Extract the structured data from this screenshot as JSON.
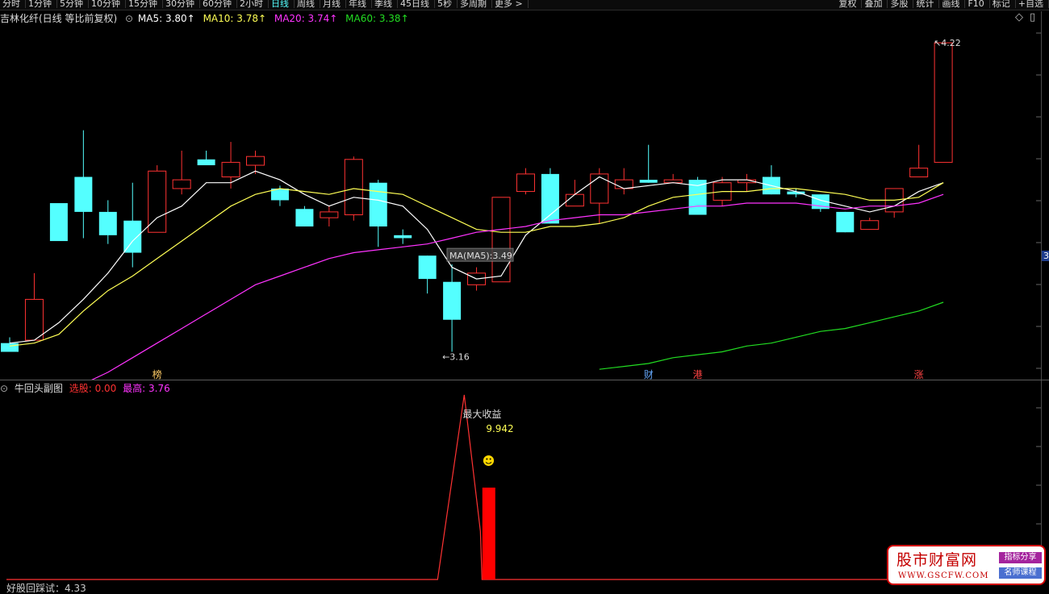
{
  "toolbar": {
    "left_items": [
      "分时",
      "1分钟",
      "5分钟",
      "10分钟",
      "15分钟",
      "30分钟",
      "60分钟",
      "2小时",
      "日线",
      "周线",
      "月线",
      "年线",
      "季线",
      "45日线",
      "5秒",
      "多周期",
      "更多 >"
    ],
    "active_index": 8,
    "right_items": [
      "复权",
      "叠加",
      "多股",
      "统计",
      "画线",
      "F10",
      "标记",
      "+自选"
    ]
  },
  "info": {
    "title": "吉林化纤(日线 等比前复权)",
    "ma5": "MA5: 3.80↑",
    "ma10": "MA10: 3.78↑",
    "ma20": "MA20: 3.74↑",
    "ma60": "MA60: 3.38↑"
  },
  "colors": {
    "up": "#ff3232",
    "down": "#54ffff",
    "ma5": "#ffffff",
    "ma10": "#ffff55",
    "ma20": "#ff33ff",
    "ma60": "#22dd22"
  },
  "chart_data": {
    "type": "candlestick",
    "ohlc": [
      [
        3.19,
        3.21,
        3.18,
        3.16
      ],
      [
        3.2,
        3.43,
        3.2,
        3.34
      ],
      [
        3.67,
        3.67,
        3.67,
        3.54
      ],
      [
        3.76,
        3.92,
        3.55,
        3.64
      ],
      [
        3.64,
        3.68,
        3.53,
        3.56
      ],
      [
        3.61,
        3.74,
        3.45,
        3.5
      ],
      [
        3.57,
        3.8,
        3.57,
        3.78
      ],
      [
        3.72,
        3.85,
        3.7,
        3.75
      ],
      [
        3.82,
        3.85,
        3.81,
        3.8
      ],
      [
        3.76,
        3.88,
        3.72,
        3.81
      ],
      [
        3.8,
        3.85,
        3.77,
        3.83
      ],
      [
        3.72,
        3.73,
        3.66,
        3.68
      ],
      [
        3.65,
        3.66,
        3.59,
        3.59
      ],
      [
        3.62,
        3.66,
        3.59,
        3.64
      ],
      [
        3.63,
        3.83,
        3.61,
        3.82
      ],
      [
        3.74,
        3.75,
        3.52,
        3.59
      ],
      [
        3.56,
        3.58,
        3.53,
        3.55
      ],
      [
        3.49,
        3.49,
        3.36,
        3.41
      ],
      [
        3.4,
        3.46,
        3.16,
        3.27
      ],
      [
        3.39,
        3.45,
        3.37,
        3.43
      ],
      [
        3.4,
        3.69,
        3.4,
        3.69
      ],
      [
        3.71,
        3.79,
        3.7,
        3.77
      ],
      [
        3.77,
        3.79,
        3.6,
        3.6
      ],
      [
        3.66,
        3.75,
        3.66,
        3.7
      ],
      [
        3.67,
        3.79,
        3.6,
        3.77
      ],
      [
        3.72,
        3.79,
        3.7,
        3.75
      ],
      [
        3.75,
        3.87,
        3.74,
        3.74
      ],
      [
        3.74,
        3.77,
        3.74,
        3.75
      ],
      [
        3.75,
        3.76,
        3.64,
        3.63
      ],
      [
        3.68,
        3.76,
        3.66,
        3.74
      ],
      [
        3.74,
        3.77,
        3.71,
        3.75
      ],
      [
        3.76,
        3.8,
        3.7,
        3.7
      ],
      [
        3.71,
        3.72,
        3.69,
        3.7
      ],
      [
        3.7,
        3.7,
        3.64,
        3.65
      ],
      [
        3.64,
        3.64,
        3.57,
        3.57
      ],
      [
        3.58,
        3.62,
        3.58,
        3.61
      ],
      [
        3.64,
        3.71,
        3.62,
        3.72
      ],
      [
        3.76,
        3.87,
        3.78,
        3.79
      ],
      [
        3.81,
        4.21,
        3.81,
        4.22
      ]
    ],
    "ma5": [
      3.19,
      3.2,
      3.26,
      3.34,
      3.43,
      3.54,
      3.62,
      3.66,
      3.74,
      3.74,
      3.78,
      3.75,
      3.7,
      3.66,
      3.69,
      3.68,
      3.66,
      3.58,
      3.45,
      3.41,
      3.42,
      3.56,
      3.63,
      3.7,
      3.76,
      3.72,
      3.73,
      3.74,
      3.73,
      3.75,
      3.75,
      3.73,
      3.71,
      3.68,
      3.66,
      3.64,
      3.66,
      3.71,
      3.74
    ],
    "ma10": [
      3.18,
      3.19,
      3.22,
      3.3,
      3.37,
      3.42,
      3.48,
      3.54,
      3.6,
      3.66,
      3.7,
      3.72,
      3.71,
      3.7,
      3.72,
      3.71,
      3.7,
      3.66,
      3.62,
      3.58,
      3.57,
      3.57,
      3.59,
      3.59,
      3.6,
      3.62,
      3.66,
      3.69,
      3.7,
      3.71,
      3.71,
      3.72,
      3.72,
      3.71,
      3.7,
      3.68,
      3.68,
      3.69,
      3.74
    ],
    "ma20": [
      2.92,
      2.96,
      3.0,
      3.05,
      3.09,
      3.14,
      3.19,
      3.24,
      3.29,
      3.34,
      3.39,
      3.42,
      3.45,
      3.48,
      3.5,
      3.51,
      3.52,
      3.53,
      3.55,
      3.57,
      3.58,
      3.59,
      3.61,
      3.62,
      3.63,
      3.63,
      3.64,
      3.65,
      3.66,
      3.66,
      3.67,
      3.67,
      3.67,
      3.66,
      3.65,
      3.66,
      3.66,
      3.67,
      3.7
    ],
    "ma60": [
      null,
      null,
      null,
      null,
      null,
      null,
      null,
      null,
      null,
      null,
      null,
      null,
      null,
      null,
      null,
      null,
      null,
      null,
      null,
      null,
      null,
      null,
      null,
      null,
      3.1,
      3.11,
      3.12,
      3.14,
      3.15,
      3.16,
      3.18,
      3.19,
      3.21,
      3.23,
      3.24,
      3.26,
      3.28,
      3.3,
      3.33
    ],
    "y_range": [
      3.12,
      4.27
    ],
    "annotations": [
      {
        "text": "4.22",
        "index": 38,
        "value": 4.22,
        "kind": "high"
      },
      {
        "text": "3.16",
        "index": 18,
        "value": 3.16,
        "kind": "low"
      }
    ],
    "tooltip": "MA(MA5):3.49",
    "markers": [
      {
        "text": "榜",
        "index": 6,
        "color": "#ffcc66"
      },
      {
        "text": "财",
        "index": 26,
        "color": "#66aaff"
      },
      {
        "text": "港",
        "index": 28,
        "color": "#ff4444"
      },
      {
        "text": "涨",
        "index": 37,
        "color": "#ff4444"
      }
    ]
  },
  "axis_right_label": "3",
  "sub_panel": {
    "title": "牛回头副图",
    "select_label": "选股: 0.00",
    "high_label": "最高: 3.76",
    "peak_label": "最大收益",
    "peak_value": "9.942",
    "smiley": "☻",
    "bottom_label": "好股回踩试：4.33",
    "line_peak_index": 18.5,
    "red_bar_index": 19.5,
    "red_bar_value": 3.76,
    "line_value": 9.942
  },
  "watermark": {
    "title": "股市财富网",
    "url": "WWW.GSCFW.COM",
    "badge1": "指标分享",
    "badge2": "名师课程"
  }
}
